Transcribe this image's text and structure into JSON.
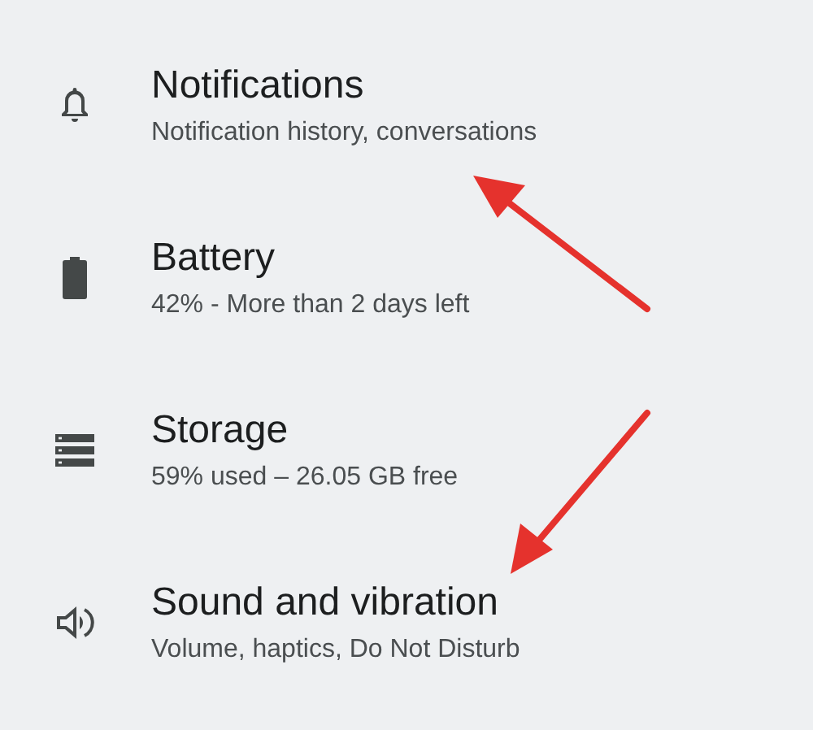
{
  "settings": [
    {
      "title": "Notifications",
      "summary": "Notification history, conversations"
    },
    {
      "title": "Battery",
      "summary": "42% - More than 2 days left"
    },
    {
      "title": "Storage",
      "summary": "59% used – 26.05 GB free"
    },
    {
      "title": "Sound and vibration",
      "summary": "Volume, haptics, Do Not Disturb"
    }
  ]
}
